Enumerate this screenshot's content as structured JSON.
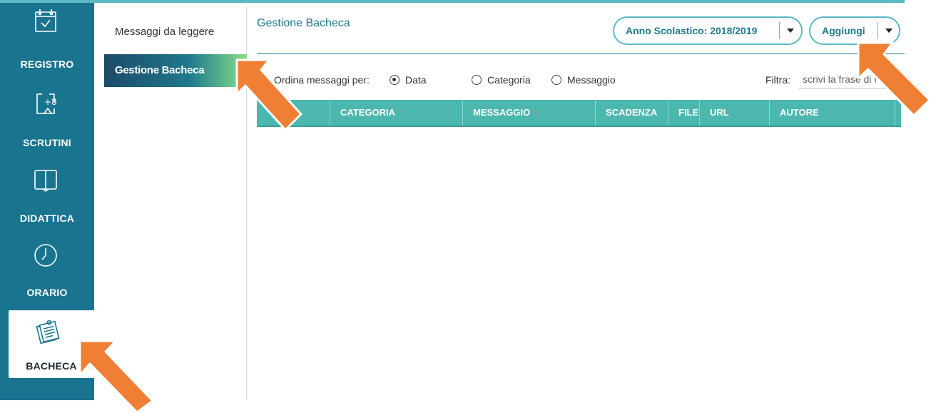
{
  "nav": {
    "items": [
      {
        "label": "REGISTRO",
        "icon": "calendar-check-icon"
      },
      {
        "label": "SCRUTINI",
        "icon": "scrutini-icon"
      },
      {
        "label": "DIDATTICA",
        "icon": "book-icon"
      },
      {
        "label": "ORARIO",
        "icon": "clock-icon"
      },
      {
        "label": "BACHECA",
        "icon": "notepad-icon",
        "active": true
      }
    ]
  },
  "submenu": {
    "items": [
      {
        "label": "Messaggi da leggere"
      },
      {
        "label": "Gestione Bacheca",
        "active": true
      }
    ]
  },
  "header": {
    "title": "Gestione Bacheca",
    "year_label": "Anno Scolastico: 2018/2019",
    "add_label": "Aggiungi"
  },
  "toolbar": {
    "sort_label": "Ordina messaggi per:",
    "options": [
      "Data",
      "Categoria",
      "Messaggio"
    ],
    "selected": "Data",
    "filter_label": "Filtra:",
    "filter_placeholder": "scrivi la frase di r"
  },
  "table": {
    "columns": [
      {
        "label": "",
        "sort_arrow": "↓"
      },
      {
        "label": "CATEGORIA",
        "sort_arrow": "↑"
      },
      {
        "label": "MESSAGGIO",
        "sort_arrow": "↑"
      },
      {
        "label": "SCADENZA",
        "sort_arrow": ""
      },
      {
        "label": "FILE",
        "sort_arrow": ""
      },
      {
        "label": "URL",
        "sort_arrow": ""
      },
      {
        "label": "AUTORE",
        "sort_arrow": ""
      }
    ],
    "rows": []
  },
  "colors": {
    "nav_bg": "#19748f",
    "accent": "#1f7a8c",
    "table_header": "#4cb7ae",
    "arrow": "#ef7f35"
  }
}
